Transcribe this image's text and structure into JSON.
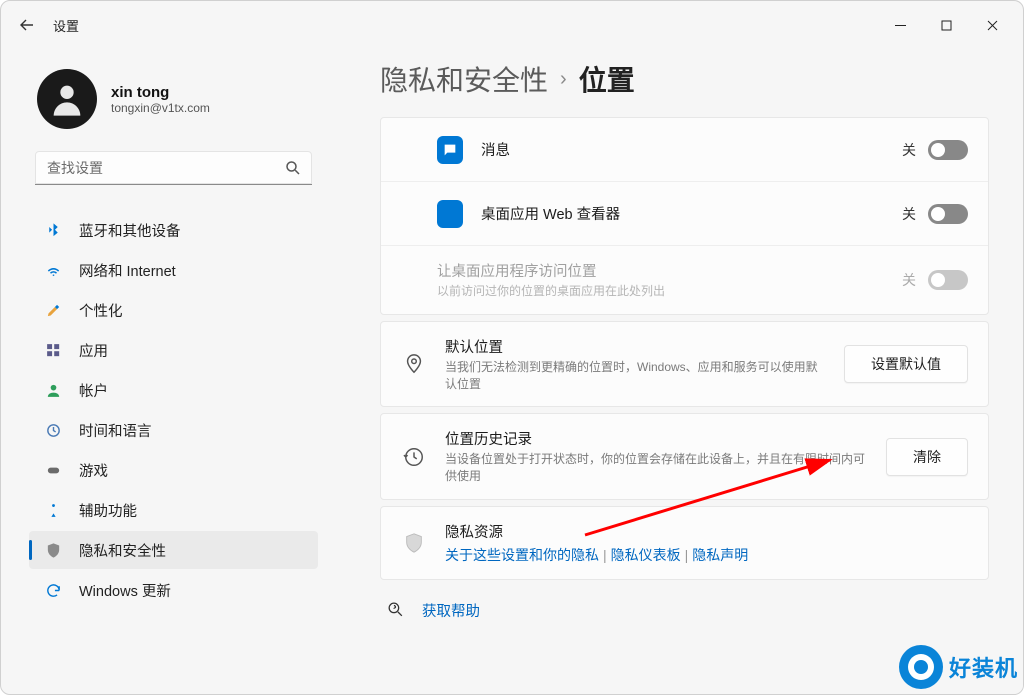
{
  "app_title": "设置",
  "profile": {
    "name": "xin tong",
    "email": "tongxin@v1tx.com"
  },
  "search": {
    "placeholder": "查找设置"
  },
  "nav": {
    "items": [
      {
        "label": "蓝牙和其他设备"
      },
      {
        "label": "网络和 Internet"
      },
      {
        "label": "个性化"
      },
      {
        "label": "应用"
      },
      {
        "label": "帐户"
      },
      {
        "label": "时间和语言"
      },
      {
        "label": "游戏"
      },
      {
        "label": "辅助功能"
      },
      {
        "label": "隐私和安全性"
      },
      {
        "label": "Windows 更新"
      }
    ],
    "selected_index": 8
  },
  "breadcrumb": {
    "parent": "隐私和安全性",
    "current": "位置"
  },
  "rows": {
    "messaging": {
      "title": "消息",
      "state": "关"
    },
    "webviewer": {
      "title": "桌面应用 Web 查看器",
      "state": "关"
    },
    "desktop_access": {
      "title": "让桌面应用程序访问位置",
      "desc": "以前访问过你的位置的桌面应用在此处列出",
      "state": "关"
    },
    "default_location": {
      "title": "默认位置",
      "desc": "当我们无法检测到更精确的位置时，Windows、应用和服务可以使用默认位置",
      "button": "设置默认值"
    },
    "history": {
      "title": "位置历史记录",
      "desc": "当设备位置处于打开状态时，你的位置会存储在此设备上，并且在有限时间内可供使用",
      "button": "清除"
    },
    "privacy_resources": {
      "title": "隐私资源",
      "link1": "关于这些设置和你的隐私",
      "link2": "隐私仪表板",
      "link3": "隐私声明"
    }
  },
  "help": {
    "label": "获取帮助"
  },
  "watermark": {
    "text": "好装机"
  }
}
